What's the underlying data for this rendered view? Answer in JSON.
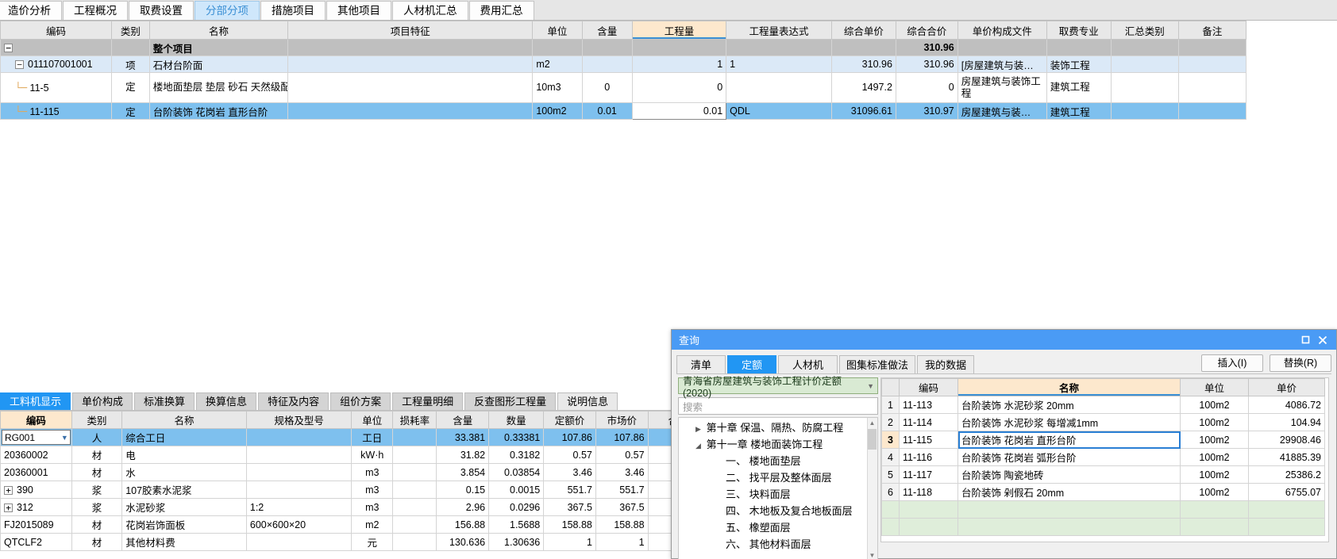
{
  "top_tabs": [
    {
      "label": "造价分析",
      "active": false
    },
    {
      "label": "工程概况",
      "active": false
    },
    {
      "label": "取费设置",
      "active": false
    },
    {
      "label": "分部分项",
      "active": true
    },
    {
      "label": "措施项目",
      "active": false
    },
    {
      "label": "其他项目",
      "active": false
    },
    {
      "label": "人材机汇总",
      "active": false
    },
    {
      "label": "费用汇总",
      "active": false
    }
  ],
  "main_grid": {
    "columns": [
      "编码",
      "类别",
      "名称",
      "项目特征",
      "单位",
      "含量",
      "工程量",
      "工程量表达式",
      "综合单价",
      "综合合价",
      "单价构成文件",
      "取费专业",
      "汇总类别",
      "备注"
    ],
    "rows": [
      {
        "type": "total",
        "code": "",
        "category": "",
        "name": "整个项目",
        "feature": "",
        "unit": "",
        "content": "",
        "qty": "",
        "expr": "",
        "price": "",
        "total": "310.96",
        "file": "",
        "major": "",
        "summary": "",
        "remark": ""
      },
      {
        "type": "item",
        "code": "011107001001",
        "category": "项",
        "name": "石材台阶面",
        "feature": "",
        "unit": "m2",
        "content": "",
        "qty": "1",
        "expr": "1",
        "price": "310.96",
        "total": "310.96",
        "file": "[房屋建筑与装…",
        "major": "装饰工程",
        "summary": "",
        "remark": ""
      },
      {
        "type": "norm",
        "code": "11-5",
        "category": "定",
        "name": "楼地面垫层 垫层 砂石 天然级配",
        "feature": "",
        "unit": "10m3",
        "content": "0",
        "qty": "0",
        "expr": "",
        "price": "1497.2",
        "total": "0",
        "file": "房屋建筑与装饰工程",
        "major": "建筑工程",
        "summary": "",
        "remark": ""
      },
      {
        "type": "selected",
        "code": "11-115",
        "category": "定",
        "name": "台阶装饰 花岗岩 直形台阶",
        "feature": "",
        "unit": "100m2",
        "content": "0.01",
        "qty": "0.01",
        "expr": "QDL",
        "price": "31096.61",
        "total": "310.97",
        "file": "房屋建筑与装…",
        "major": "建筑工程",
        "summary": "",
        "remark": ""
      }
    ]
  },
  "bottom_tabs": [
    {
      "label": "工料机显示",
      "active": true
    },
    {
      "label": "单价构成",
      "active": false
    },
    {
      "label": "标准换算",
      "active": false
    },
    {
      "label": "换算信息",
      "active": false
    },
    {
      "label": "特征及内容",
      "active": false
    },
    {
      "label": "组价方案",
      "active": false
    },
    {
      "label": "工程量明细",
      "active": false
    },
    {
      "label": "反查图形工程量",
      "active": false
    },
    {
      "label": "说明信息",
      "active": false
    }
  ],
  "material_grid": {
    "columns": [
      "编码",
      "类别",
      "名称",
      "规格及型号",
      "单位",
      "损耗率",
      "含量",
      "数量",
      "定额价",
      "市场价",
      "合"
    ],
    "rows": [
      {
        "code": "RG001",
        "is_combo": true,
        "category": "人",
        "name": "综合工日",
        "spec": "",
        "unit": "工日",
        "loss": "",
        "content": "33.381",
        "qty": "0.33381",
        "norm_price": "107.86",
        "market_price": "107.86",
        "selected": true
      },
      {
        "code": "20360002",
        "expandable": false,
        "category": "材",
        "name": "电",
        "spec": "",
        "unit": "kW·h",
        "loss": "",
        "content": "31.82",
        "qty": "0.3182",
        "norm_price": "0.57",
        "market_price": "0.57",
        "selected": false
      },
      {
        "code": "20360001",
        "expandable": false,
        "category": "材",
        "name": "水",
        "spec": "",
        "unit": "m3",
        "loss": "",
        "content": "3.854",
        "qty": "0.03854",
        "norm_price": "3.46",
        "market_price": "3.46",
        "selected": false
      },
      {
        "code": "390",
        "expandable": true,
        "category": "浆",
        "name": "107胶素水泥浆",
        "spec": "",
        "unit": "m3",
        "loss": "",
        "content": "0.15",
        "qty": "0.0015",
        "norm_price": "551.7",
        "market_price": "551.7",
        "selected": false
      },
      {
        "code": "312",
        "expandable": true,
        "category": "浆",
        "name": "水泥砂浆",
        "spec": "1:2",
        "unit": "m3",
        "loss": "",
        "content": "2.96",
        "qty": "0.0296",
        "norm_price": "367.5",
        "market_price": "367.5",
        "selected": false
      },
      {
        "code": "FJ2015089",
        "expandable": false,
        "category": "材",
        "name": "花岗岩饰面板",
        "spec": "600×600×20",
        "unit": "m2",
        "loss": "",
        "content": "156.88",
        "qty": "1.5688",
        "norm_price": "158.88",
        "market_price": "158.88",
        "selected": false
      },
      {
        "code": "QTCLF2",
        "expandable": false,
        "category": "材",
        "name": "其他材料费",
        "spec": "",
        "unit": "元",
        "loss": "",
        "content": "130.636",
        "qty": "1.30636",
        "norm_price": "1",
        "market_price": "1",
        "selected": false
      }
    ]
  },
  "dialog": {
    "title": "查询",
    "maximize_icon": "maximize-icon",
    "close_icon": "close-icon",
    "tabs": [
      {
        "label": "清单",
        "active": false
      },
      {
        "label": "定额",
        "active": true
      },
      {
        "label": "人材机",
        "active": false
      },
      {
        "label": "图集标准做法",
        "active": false
      },
      {
        "label": "我的数据",
        "active": false
      }
    ],
    "actions": [
      {
        "label": "插入(I)"
      },
      {
        "label": "替换(R)"
      }
    ],
    "library": "青海省房屋建筑与装饰工程计价定额(2020)",
    "search_placeholder": "搜索",
    "tree": [
      {
        "label": "第十章 保温、隔热、防腐工程",
        "level": 1,
        "state": "collapsed"
      },
      {
        "label": "第十一章 楼地面装饰工程",
        "level": 1,
        "state": "expanded"
      },
      {
        "label": "一、 楼地面垫层",
        "level": 2,
        "state": "leaf"
      },
      {
        "label": "二、 找平层及整体面层",
        "level": 2,
        "state": "leaf"
      },
      {
        "label": "三、 块料面层",
        "level": 2,
        "state": "leaf"
      },
      {
        "label": "四、 木地板及复合地板面层",
        "level": 2,
        "state": "leaf"
      },
      {
        "label": "五、 橡塑面层",
        "level": 2,
        "state": "leaf"
      },
      {
        "label": "六、 其他材料面层",
        "level": 2,
        "state": "leaf"
      }
    ],
    "grid": {
      "columns": [
        "",
        "编码",
        "名称",
        "单位",
        "单价"
      ],
      "rows": [
        {
          "no": "1",
          "code": "11-113",
          "name": "台阶装饰 水泥砂浆 20mm",
          "unit": "100m2",
          "price": "4086.72",
          "selected": false
        },
        {
          "no": "2",
          "code": "11-114",
          "name": "台阶装饰 水泥砂浆 每增减1mm",
          "unit": "100m2",
          "price": "104.94",
          "selected": false
        },
        {
          "no": "3",
          "code": "11-115",
          "name": "台阶装饰 花岗岩 直形台阶",
          "unit": "100m2",
          "price": "29908.46",
          "selected": true
        },
        {
          "no": "4",
          "code": "11-116",
          "name": "台阶装饰 花岗岩 弧形台阶",
          "unit": "100m2",
          "price": "41885.39",
          "selected": false
        },
        {
          "no": "5",
          "code": "11-117",
          "name": "台阶装饰 陶瓷地砖",
          "unit": "100m2",
          "price": "25386.2",
          "selected": false
        },
        {
          "no": "6",
          "code": "11-118",
          "name": "台阶装饰 剁假石 20mm",
          "unit": "100m2",
          "price": "6755.07",
          "selected": false
        }
      ]
    }
  },
  "colors": {
    "accent": "#2196f3",
    "tab_active_bg": "#cfe7fb",
    "row_selected": "#7ec0ee",
    "col_highlight": "#fde8cd",
    "total_row": "#bfbfbf"
  }
}
